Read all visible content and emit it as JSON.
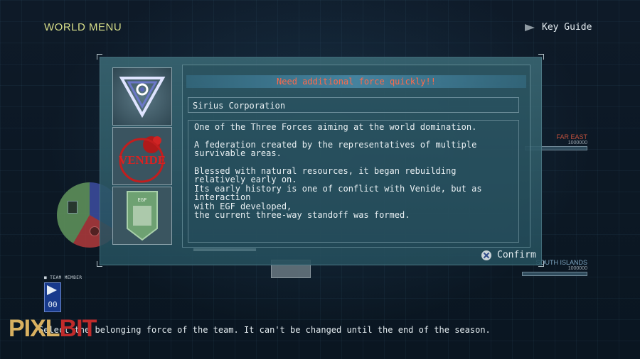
{
  "header": {
    "title": "WORLD MENU",
    "key_guide_label": "Key Guide"
  },
  "map": {
    "regions": [
      {
        "name": "FAR EAST",
        "value": "1000000"
      },
      {
        "name": "SOUTH ISLANDS",
        "value": "1000000"
      }
    ]
  },
  "dialog": {
    "headline": "Need additional force quickly!!",
    "force_name": "Sirius Corporation",
    "description": [
      "One of the Three Forces aiming at the world domination.",
      "A federation created by the representatives of multiple\nsurvivable areas.",
      "Blessed with natural resources, it began rebuilding\nrelatively early on.\nIts early history is one of conflict with Venide, but as interaction\nwith EGF developed,\nthe current three-way standoff was formed."
    ],
    "emblems": [
      {
        "name": "sirius-emblem",
        "label": ""
      },
      {
        "name": "venide-emblem",
        "label": "VENIDE"
      },
      {
        "name": "egf-emblem",
        "label": "EGF"
      }
    ],
    "confirm_label": "Confirm"
  },
  "team": {
    "label": "TEAM MEMBER",
    "count": "00"
  },
  "footer": {
    "hint": "Select the belonging force of the team. It can't be changed until the end of the season."
  },
  "watermark": {
    "part1": "PIXL",
    "part2": "BIT"
  },
  "colors": {
    "headline": "#ff6a4a",
    "title": "#d8df8a",
    "sirius": "#3a4a9a",
    "venide": "#a8383a",
    "egf": "#5d8f5a"
  }
}
